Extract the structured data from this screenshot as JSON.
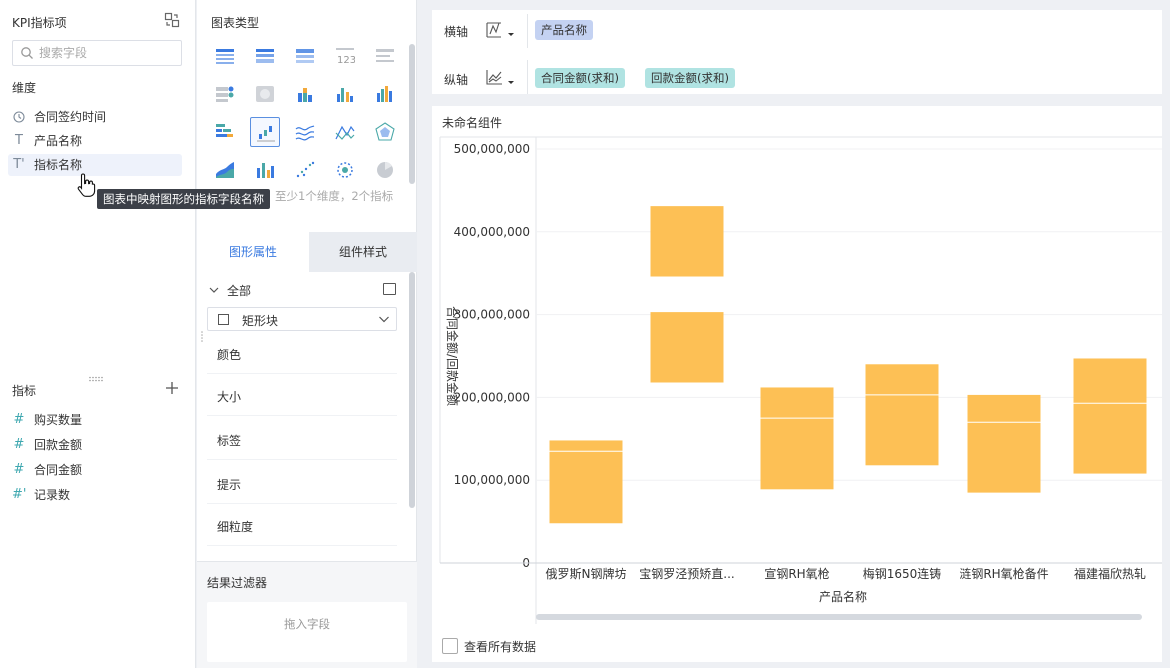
{
  "left_panel": {
    "title": "KPI指标项",
    "search_placeholder": "搜索字段",
    "dimension_section": "维度",
    "dimensions": [
      {
        "icon": "clock-icon",
        "glyph": "🕔",
        "label": "合同签约时间"
      },
      {
        "icon": "text-type-icon",
        "glyph": "T",
        "label": "产品名称"
      },
      {
        "icon": "text-type-icon",
        "glyph": "T'",
        "label": "指标名称"
      }
    ],
    "measure_section": "指标",
    "measures": [
      {
        "icon": "hash-icon",
        "glyph": "#",
        "label": "购买数量"
      },
      {
        "icon": "hash-icon",
        "glyph": "#",
        "label": "回款金额"
      },
      {
        "icon": "hash-icon",
        "glyph": "#",
        "label": "合同金额"
      },
      {
        "icon": "hash-icon",
        "glyph": "#'",
        "label": "记录数"
      }
    ],
    "tooltip": "图表中映射图形的指标字段名称"
  },
  "middle_panel": {
    "chart_type_title": "图表类型",
    "chart_types": [
      "table",
      "cross-table",
      "detail-table",
      "kpi-number",
      "text",
      "dot-map",
      "heat-map",
      "stacked-column",
      "grouped-column",
      "column",
      "stacked-bar",
      "range-column",
      "line",
      "multi-line",
      "radar",
      "area",
      "combo",
      "scatter",
      "bubble",
      "pie"
    ],
    "selected_chart_type": "range-column",
    "hint_text": "至少1个维度，2个指标",
    "tabs": [
      "图形属性",
      "组件样式"
    ],
    "all_label": "全部",
    "shape_value": "矩形块",
    "properties": [
      "颜色",
      "大小",
      "标签",
      "提示",
      "细粒度"
    ],
    "result_filter_title": "结果过滤器",
    "drop_field_text": "拖入字段"
  },
  "axis_bar": {
    "x_label": "横轴",
    "x_fields": [
      "产品名称"
    ],
    "y_label": "纵轴",
    "y_fields": [
      "合同金额(求和)",
      "回款金额(求和)"
    ]
  },
  "component": {
    "title": "未命名组件",
    "view_all_label": "查看所有数据"
  },
  "colors": {
    "bar": "#fdc055",
    "accent": "#3a7ae0",
    "x_pill": "#c4d2f2",
    "y_pill": "#b0e3e2"
  },
  "chart_data": {
    "type": "bar",
    "subtype": "range",
    "xlabel": "产品名称",
    "ylabel": "合同金额/回款金额",
    "ylim": [
      0,
      500000000
    ],
    "ticks": [
      0,
      100000000,
      200000000,
      300000000,
      400000000,
      500000000
    ],
    "tick_labels": [
      "0",
      "100,000,000",
      "200,000,000",
      "300,000,000",
      "400,000,000",
      "500,000,000"
    ],
    "categories": [
      "俄罗斯N钢牌坊",
      "宝钢罗泾预矫直...",
      "宣钢RH氧枪",
      "梅钢1650连铸",
      "涟钢RH氧枪备件",
      "福建福欣热轧"
    ],
    "ranges": [
      [
        [
          48000000,
          148000000
        ]
      ],
      [
        [
          218000000,
          303000000
        ],
        [
          346000000,
          431000000
        ]
      ],
      [
        [
          89000000,
          212000000
        ]
      ],
      [
        [
          118000000,
          240000000
        ]
      ],
      [
        [
          85000000,
          203000000
        ]
      ],
      [
        [
          108000000,
          247000000
        ]
      ]
    ],
    "inner_lines": [
      [
        135000000
      ],
      [],
      [
        175000000
      ],
      [
        203000000
      ],
      [
        170000000
      ],
      [
        193000000
      ]
    ]
  }
}
